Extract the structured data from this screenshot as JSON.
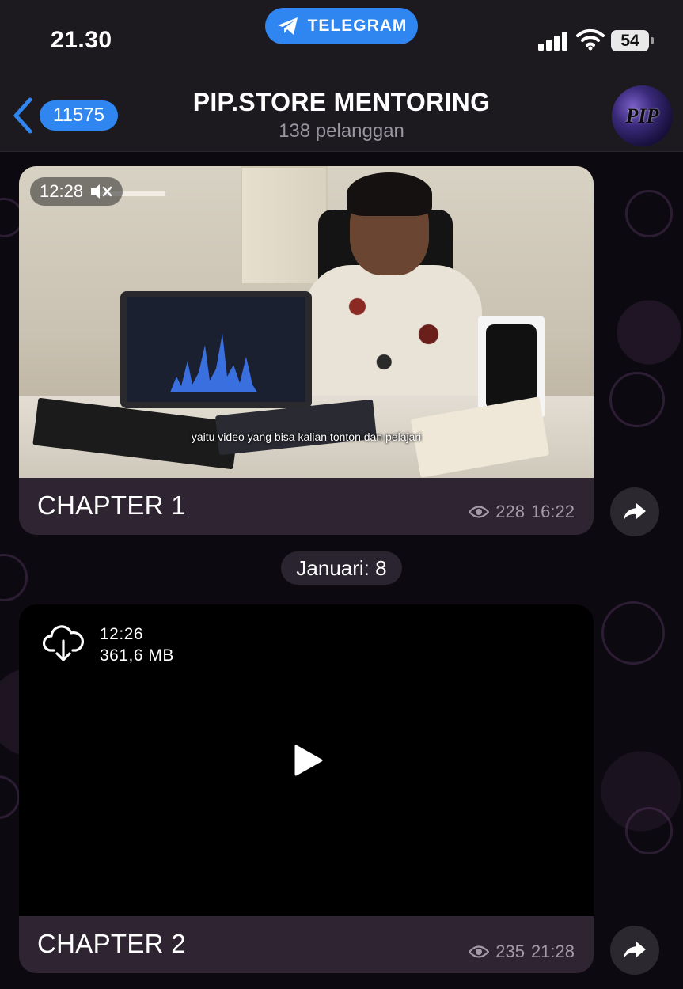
{
  "status_bar": {
    "time": "21.30",
    "app_pill": "TELEGRAM",
    "battery": "54"
  },
  "header": {
    "back_count": "11575",
    "title": "PIP.STORE MENTORING",
    "subtitle": "138 pelanggan",
    "avatar_text": "PIP"
  },
  "messages": [
    {
      "duration": "12:28",
      "video_caption": "yaitu video yang bisa kalian tonton dan pelajari",
      "caption": "CHAPTER 1",
      "views": "228",
      "time": "16:22"
    },
    {
      "duration": "12:26",
      "size": "361,6 MB",
      "caption": "CHAPTER 2",
      "views": "235",
      "time": "21:28"
    }
  ],
  "date_separator": "Januari: 8",
  "colors": {
    "accent": "#2f86f0",
    "bubble": "#2e2432",
    "header": "#1c191f",
    "meta_text": "#a39ca8"
  },
  "icons": [
    "telegram-icon",
    "signal-icon",
    "wifi-icon",
    "back-chevron-icon",
    "muted-speaker-icon",
    "eye-icon",
    "share-arrow-icon",
    "cloud-download-icon",
    "play-icon"
  ]
}
